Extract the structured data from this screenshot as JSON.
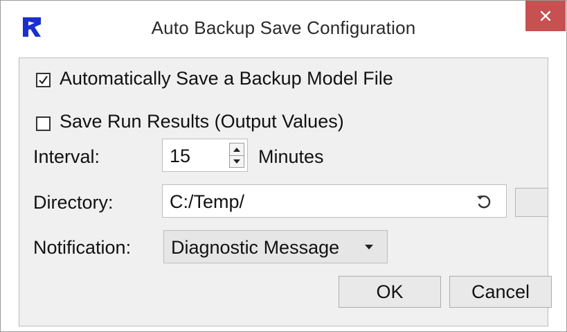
{
  "window": {
    "title": "Auto Backup Save Configuration",
    "close_icon": "close-icon",
    "app_icon": "app-logo-icon",
    "accent_color": "#1a2fcf",
    "close_color": "#c75050"
  },
  "options": {
    "auto_save": {
      "label": "Automatically Save a Backup Model File",
      "checked": true
    },
    "save_results": {
      "label": "Save Run Results (Output Values)",
      "checked": false
    }
  },
  "interval": {
    "label": "Interval:",
    "value": "15",
    "unit": "Minutes"
  },
  "directory": {
    "label": "Directory:",
    "value": "C:/Temp/",
    "reset_icon": "reset-icon"
  },
  "notification": {
    "label": "Notification:",
    "selected": "Diagnostic Message"
  },
  "buttons": {
    "ok": "OK",
    "cancel": "Cancel"
  }
}
